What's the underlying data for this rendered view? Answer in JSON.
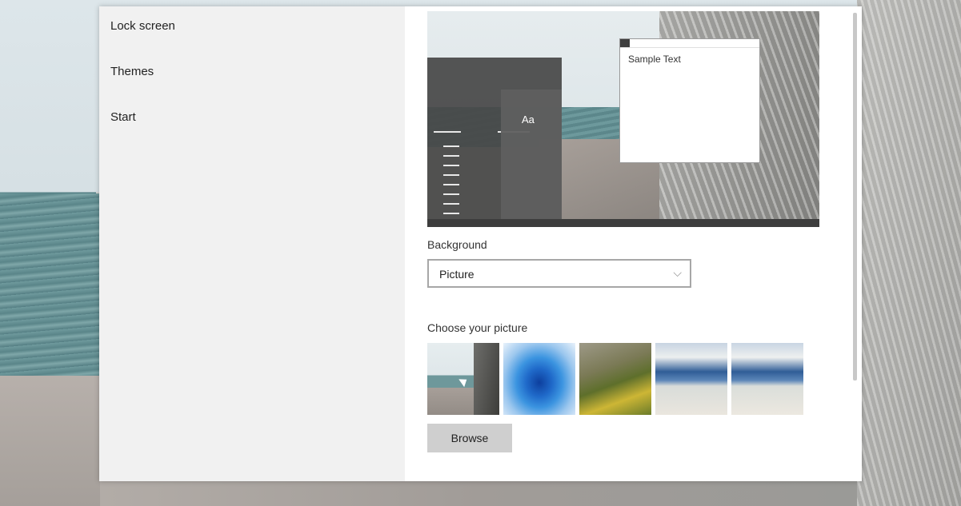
{
  "nav": {
    "items": [
      {
        "label": "Lock screen"
      },
      {
        "label": "Themes"
      },
      {
        "label": "Start"
      }
    ]
  },
  "preview": {
    "tile_text": "Aa",
    "window_sample_text": "Sample Text"
  },
  "background": {
    "label": "Background",
    "selected": "Picture",
    "chevron": "⌵"
  },
  "picture": {
    "label": "Choose your picture",
    "thumbnails": [
      "pier-and-rock",
      "blue-abstract",
      "yellow-hills",
      "beach-waves-1",
      "beach-waves-2"
    ],
    "browse_label": "Browse"
  },
  "colors": {
    "window_bg": "#ffffff",
    "nav_bg": "#f1f1f1",
    "button_bg": "#cfcfcf"
  }
}
